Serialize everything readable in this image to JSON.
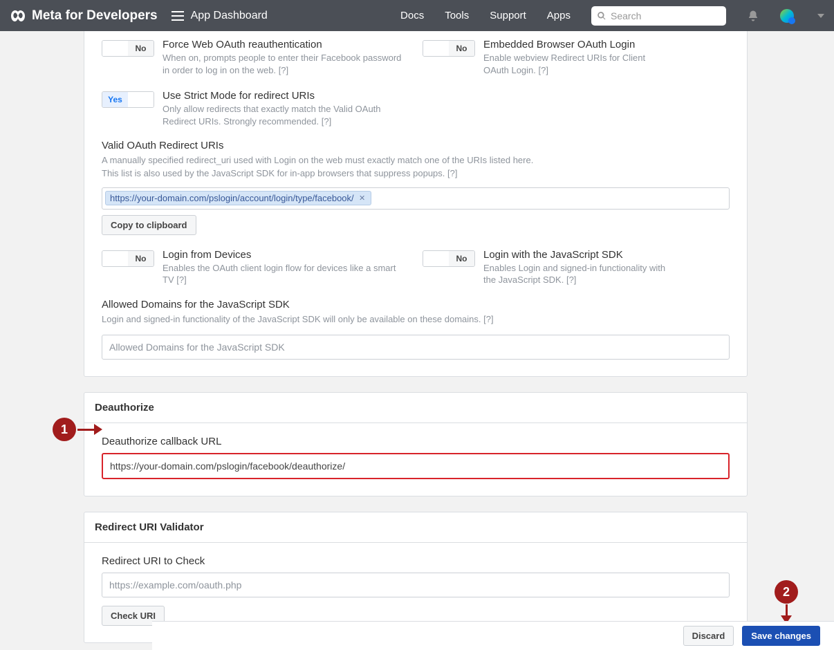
{
  "header": {
    "brand": "Meta for Developers",
    "page": "App Dashboard",
    "nav": [
      "Docs",
      "Tools",
      "Support",
      "Apps"
    ],
    "search_placeholder": "Search"
  },
  "toggle_labels": {
    "yes": "Yes",
    "no": "No"
  },
  "help_marker": "[?]",
  "opts": {
    "force": {
      "title": "Force Web OAuth reauthentication",
      "desc": "When on, prompts people to enter their Facebook password in order to log in on the web.",
      "value": "No"
    },
    "embed": {
      "title": "Embedded Browser OAuth Login",
      "desc": "Enable webview Redirect URIs for Client OAuth Login.",
      "value": "No"
    },
    "strict": {
      "title": "Use Strict Mode for redirect URIs",
      "desc": "Only allow redirects that exactly match the Valid OAuth Redirect URIs. Strongly recommended.",
      "value": "Yes"
    }
  },
  "valid_uris": {
    "title": "Valid OAuth Redirect URIs",
    "desc1": "A manually specified redirect_uri used with Login on the web must exactly match one of the URIs listed here.",
    "desc2": "This list is also used by the JavaScript SDK for in-app browsers that suppress popups.",
    "chip": "https://your-domain.com/pslogin/account/login/type/facebook/",
    "copy_btn": "Copy to clipboard"
  },
  "opts2": {
    "devices": {
      "title": "Login from Devices",
      "desc": "Enables the OAuth client login flow for devices like a smart TV",
      "value": "No"
    },
    "jssdk": {
      "title": "Login with the JavaScript SDK",
      "desc": "Enables Login and signed-in functionality with the JavaScript SDK.",
      "value": "No"
    }
  },
  "domains": {
    "title": "Allowed Domains for the JavaScript SDK",
    "desc": "Login and signed-in functionality of the JavaScript SDK will only be available on these domains.",
    "placeholder": "Allowed Domains for the JavaScript SDK"
  },
  "deauth": {
    "header": "Deauthorize",
    "label": "Deauthorize callback URL",
    "value": "https://your-domain.com/pslogin/facebook/deauthorize/"
  },
  "validator": {
    "header": "Redirect URI Validator",
    "label": "Redirect URI to Check",
    "placeholder": "https://example.com/oauth.php",
    "check_btn": "Check URI"
  },
  "footer": {
    "discard": "Discard",
    "save": "Save changes"
  },
  "badges": {
    "one": "1",
    "two": "2"
  }
}
